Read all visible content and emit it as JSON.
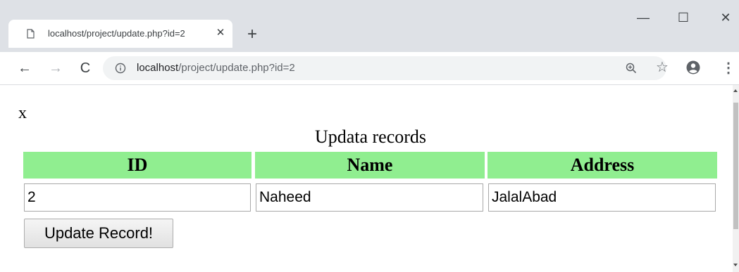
{
  "browser": {
    "tab": {
      "title": "localhost/project/update.php?id=2",
      "close": "✕"
    },
    "new_tab": "+",
    "window_controls": {
      "minimize": "—",
      "maximize": "☐",
      "close": "✕"
    },
    "nav": {
      "back": "←",
      "forward": "→",
      "reload": "C"
    },
    "address_bar": {
      "host": "localhost",
      "path": "/project/update.php?id=2"
    },
    "icons": [
      "page-icon",
      "info-icon",
      "zoom-icon",
      "star-icon",
      "profile-icon",
      "menu-icon"
    ],
    "star": "☆",
    "menu": "⋮"
  },
  "page": {
    "stray_text": "x",
    "caption": "Updata records",
    "headers": [
      "ID",
      "Name",
      "Address"
    ],
    "fields": {
      "id": "2",
      "name": "Naheed",
      "address": "JalalAbad"
    },
    "submit_label": "Update Record!"
  },
  "colors": {
    "header_bg": "#90ee90",
    "chrome_bg": "#dee1e6",
    "omnibox_bg": "#f1f3f4"
  }
}
